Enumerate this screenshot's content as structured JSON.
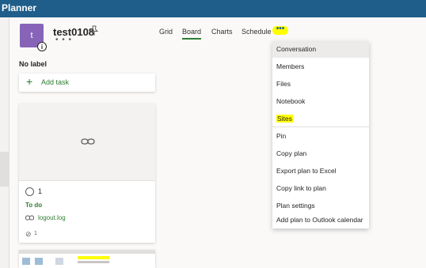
{
  "app": {
    "title": "Planner"
  },
  "plan": {
    "avatar_letter": "t",
    "name": "test0108",
    "more": "• • •",
    "info": "i"
  },
  "tabs": [
    {
      "label": "Grid"
    },
    {
      "label": "Board"
    },
    {
      "label": "Charts"
    },
    {
      "label": "Schedule"
    }
  ],
  "more_button": {
    "label": "•••"
  },
  "bucket": {
    "name": "No label",
    "add_task": "Add task",
    "add_icon": "+"
  },
  "task": {
    "title": "1",
    "bucket": "To do",
    "attachment": "logout.log",
    "attachment_count": "1"
  },
  "menu": {
    "items": [
      {
        "label": "Conversation"
      },
      {
        "label": "Members"
      },
      {
        "label": "Files"
      },
      {
        "label": "Notebook"
      },
      {
        "label": "Sites"
      },
      {
        "label": "Pin"
      },
      {
        "label": "Copy plan"
      },
      {
        "label": "Export plan to Excel"
      },
      {
        "label": "Copy link to plan"
      },
      {
        "label": "Plan settings"
      },
      {
        "label": "Add plan to Outlook calendar"
      }
    ]
  },
  "colors": {
    "brand": "#1f5e8a",
    "accent": "#2e7d32",
    "highlight": "#ffff00",
    "avatar": "#8764b8"
  }
}
